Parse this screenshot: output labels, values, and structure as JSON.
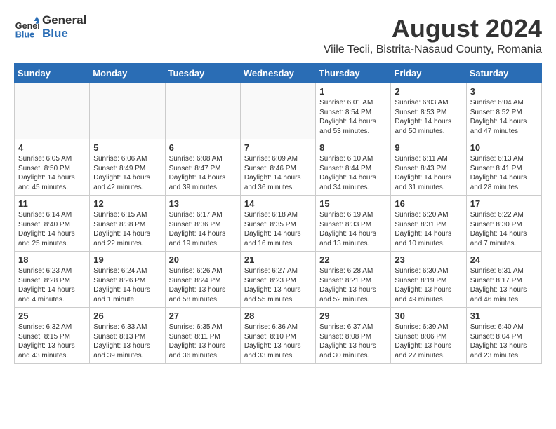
{
  "header": {
    "logo_line1": "General",
    "logo_line2": "Blue",
    "month_year": "August 2024",
    "location": "Viile Tecii, Bistrita-Nasaud County, Romania"
  },
  "weekdays": [
    "Sunday",
    "Monday",
    "Tuesday",
    "Wednesday",
    "Thursday",
    "Friday",
    "Saturday"
  ],
  "weeks": [
    [
      {
        "day": "",
        "info": ""
      },
      {
        "day": "",
        "info": ""
      },
      {
        "day": "",
        "info": ""
      },
      {
        "day": "",
        "info": ""
      },
      {
        "day": "1",
        "info": "Sunrise: 6:01 AM\nSunset: 8:54 PM\nDaylight: 14 hours\nand 53 minutes."
      },
      {
        "day": "2",
        "info": "Sunrise: 6:03 AM\nSunset: 8:53 PM\nDaylight: 14 hours\nand 50 minutes."
      },
      {
        "day": "3",
        "info": "Sunrise: 6:04 AM\nSunset: 8:52 PM\nDaylight: 14 hours\nand 47 minutes."
      }
    ],
    [
      {
        "day": "4",
        "info": "Sunrise: 6:05 AM\nSunset: 8:50 PM\nDaylight: 14 hours\nand 45 minutes."
      },
      {
        "day": "5",
        "info": "Sunrise: 6:06 AM\nSunset: 8:49 PM\nDaylight: 14 hours\nand 42 minutes."
      },
      {
        "day": "6",
        "info": "Sunrise: 6:08 AM\nSunset: 8:47 PM\nDaylight: 14 hours\nand 39 minutes."
      },
      {
        "day": "7",
        "info": "Sunrise: 6:09 AM\nSunset: 8:46 PM\nDaylight: 14 hours\nand 36 minutes."
      },
      {
        "day": "8",
        "info": "Sunrise: 6:10 AM\nSunset: 8:44 PM\nDaylight: 14 hours\nand 34 minutes."
      },
      {
        "day": "9",
        "info": "Sunrise: 6:11 AM\nSunset: 8:43 PM\nDaylight: 14 hours\nand 31 minutes."
      },
      {
        "day": "10",
        "info": "Sunrise: 6:13 AM\nSunset: 8:41 PM\nDaylight: 14 hours\nand 28 minutes."
      }
    ],
    [
      {
        "day": "11",
        "info": "Sunrise: 6:14 AM\nSunset: 8:40 PM\nDaylight: 14 hours\nand 25 minutes."
      },
      {
        "day": "12",
        "info": "Sunrise: 6:15 AM\nSunset: 8:38 PM\nDaylight: 14 hours\nand 22 minutes."
      },
      {
        "day": "13",
        "info": "Sunrise: 6:17 AM\nSunset: 8:36 PM\nDaylight: 14 hours\nand 19 minutes."
      },
      {
        "day": "14",
        "info": "Sunrise: 6:18 AM\nSunset: 8:35 PM\nDaylight: 14 hours\nand 16 minutes."
      },
      {
        "day": "15",
        "info": "Sunrise: 6:19 AM\nSunset: 8:33 PM\nDaylight: 14 hours\nand 13 minutes."
      },
      {
        "day": "16",
        "info": "Sunrise: 6:20 AM\nSunset: 8:31 PM\nDaylight: 14 hours\nand 10 minutes."
      },
      {
        "day": "17",
        "info": "Sunrise: 6:22 AM\nSunset: 8:30 PM\nDaylight: 14 hours\nand 7 minutes."
      }
    ],
    [
      {
        "day": "18",
        "info": "Sunrise: 6:23 AM\nSunset: 8:28 PM\nDaylight: 14 hours\nand 4 minutes."
      },
      {
        "day": "19",
        "info": "Sunrise: 6:24 AM\nSunset: 8:26 PM\nDaylight: 14 hours\nand 1 minute."
      },
      {
        "day": "20",
        "info": "Sunrise: 6:26 AM\nSunset: 8:24 PM\nDaylight: 13 hours\nand 58 minutes."
      },
      {
        "day": "21",
        "info": "Sunrise: 6:27 AM\nSunset: 8:23 PM\nDaylight: 13 hours\nand 55 minutes."
      },
      {
        "day": "22",
        "info": "Sunrise: 6:28 AM\nSunset: 8:21 PM\nDaylight: 13 hours\nand 52 minutes."
      },
      {
        "day": "23",
        "info": "Sunrise: 6:30 AM\nSunset: 8:19 PM\nDaylight: 13 hours\nand 49 minutes."
      },
      {
        "day": "24",
        "info": "Sunrise: 6:31 AM\nSunset: 8:17 PM\nDaylight: 13 hours\nand 46 minutes."
      }
    ],
    [
      {
        "day": "25",
        "info": "Sunrise: 6:32 AM\nSunset: 8:15 PM\nDaylight: 13 hours\nand 43 minutes."
      },
      {
        "day": "26",
        "info": "Sunrise: 6:33 AM\nSunset: 8:13 PM\nDaylight: 13 hours\nand 39 minutes."
      },
      {
        "day": "27",
        "info": "Sunrise: 6:35 AM\nSunset: 8:11 PM\nDaylight: 13 hours\nand 36 minutes."
      },
      {
        "day": "28",
        "info": "Sunrise: 6:36 AM\nSunset: 8:10 PM\nDaylight: 13 hours\nand 33 minutes."
      },
      {
        "day": "29",
        "info": "Sunrise: 6:37 AM\nSunset: 8:08 PM\nDaylight: 13 hours\nand 30 minutes."
      },
      {
        "day": "30",
        "info": "Sunrise: 6:39 AM\nSunset: 8:06 PM\nDaylight: 13 hours\nand 27 minutes."
      },
      {
        "day": "31",
        "info": "Sunrise: 6:40 AM\nSunset: 8:04 PM\nDaylight: 13 hours\nand 23 minutes."
      }
    ]
  ]
}
